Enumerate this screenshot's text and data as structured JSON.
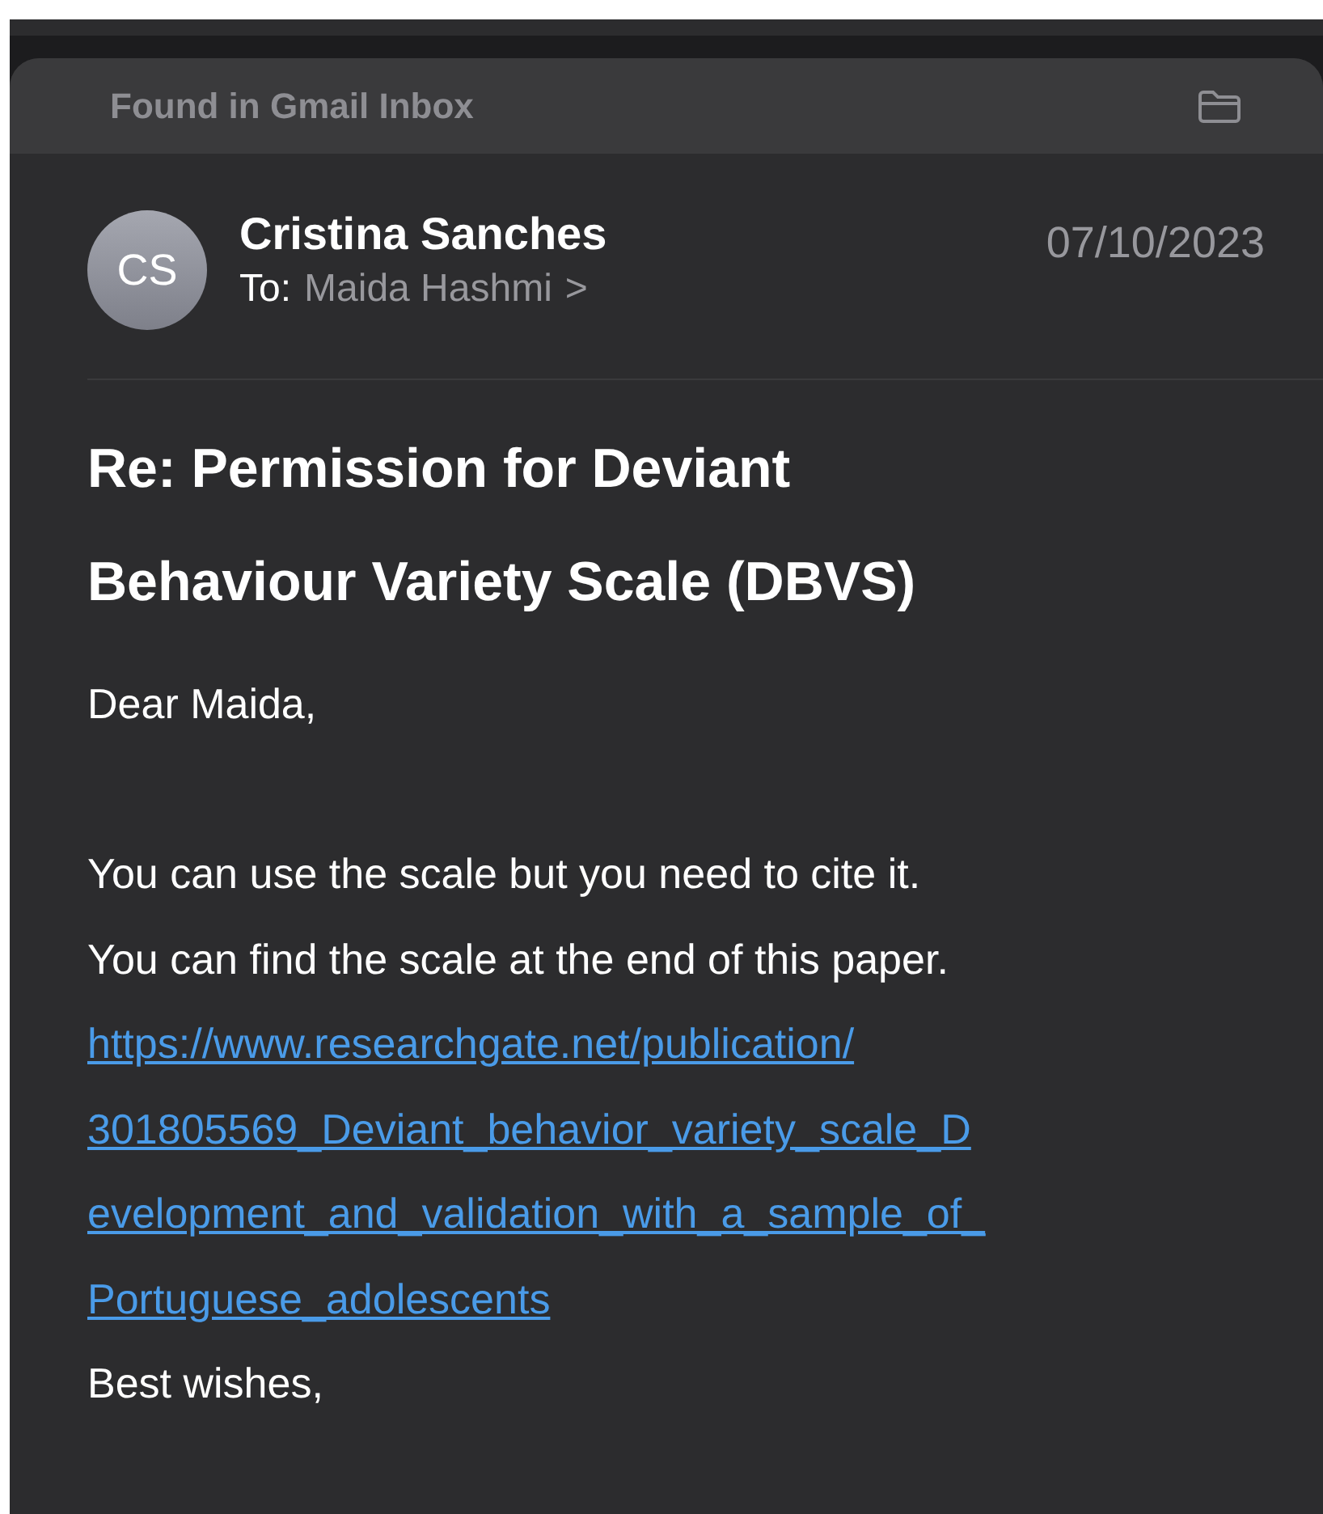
{
  "banner": {
    "label": "Found in Gmail Inbox"
  },
  "message": {
    "avatar_initials": "CS",
    "sender": "Cristina Sanches",
    "to_label": "To:",
    "recipient": "Maida Hashmi",
    "chevron": ">",
    "date": "07/10/2023"
  },
  "subject_lines": [
    "Re: Permission for Deviant",
    "Behaviour Variety Scale (DBVS)"
  ],
  "body": [
    {
      "kind": "text",
      "text": "Dear Maida,"
    },
    {
      "kind": "blank"
    },
    {
      "kind": "text",
      "text": "You can use the scale but you need to cite it."
    },
    {
      "kind": "text",
      "text": "You can find the scale at the end of this paper."
    },
    {
      "kind": "link",
      "text": "https://www.researchgate.net/publication/"
    },
    {
      "kind": "link",
      "text": "301805569_Deviant_behavior_variety_scale_D"
    },
    {
      "kind": "link",
      "text": "evelopment_and_validation_with_a_sample_of_"
    },
    {
      "kind": "link",
      "text": "Portuguese_adolescents"
    },
    {
      "kind": "text",
      "text": "Best wishes,"
    }
  ]
}
